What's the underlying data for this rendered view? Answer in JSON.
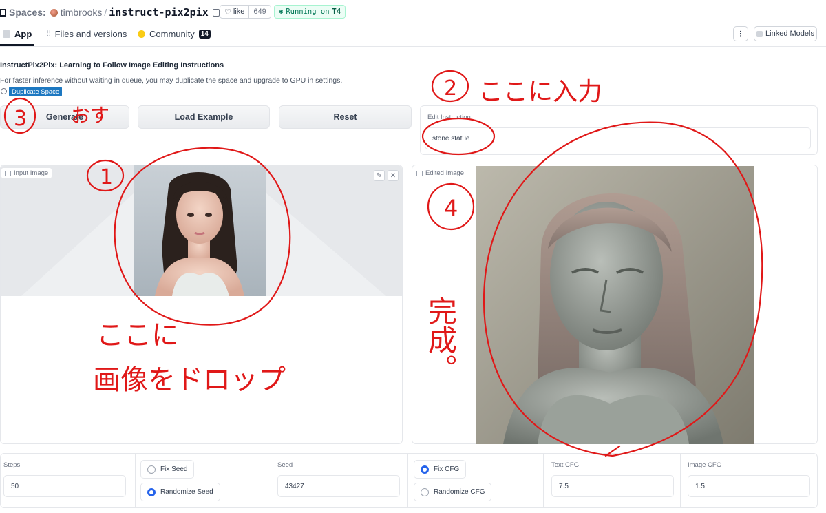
{
  "header": {
    "spaces_label": "Spaces:",
    "owner": "timbrooks",
    "separator": "/",
    "repo": "instruct-pix2pix",
    "like_label": "like",
    "like_count": "649",
    "running_prefix": "Running on",
    "running_hw": "T4",
    "tabs": [
      {
        "label": "App",
        "active": true
      },
      {
        "label": "Files and versions"
      },
      {
        "label": "Community",
        "badge": "14"
      }
    ],
    "more_label": "⋮",
    "linked_models": "Linked Models"
  },
  "app": {
    "title": "InstructPix2Pix: Learning to Follow Image Editing Instructions",
    "description": "For faster inference without waiting in queue, you may duplicate the space and upgrade to GPU in settings.",
    "duplicate_label": "Duplicate Space",
    "buttons": {
      "generate": "Generate",
      "load_example": "Load Example",
      "reset": "Reset"
    },
    "edit_instruction": {
      "label": "Edit Instruction",
      "value": "stone statue"
    },
    "input_image_label": "Input Image",
    "edited_image_label": "Edited Image",
    "controls": {
      "steps": {
        "label": "Steps",
        "value": "50"
      },
      "fix_seed": "Fix Seed",
      "randomize_seed": "Randomize Seed",
      "seed_mode": "Randomize Seed",
      "seed": {
        "label": "Seed",
        "value": "43427"
      },
      "fix_cfg": "Fix CFG",
      "randomize_cfg": "Randomize CFG",
      "cfg_mode": "Fix CFG",
      "text_cfg": {
        "label": "Text CFG",
        "value": "7.5"
      },
      "image_cfg": {
        "label": "Image CFG",
        "value": "1.5"
      }
    }
  },
  "annotations": {
    "n1": "1",
    "n2": "2",
    "n3": "3",
    "n4": "4",
    "push": "おす",
    "type_here": "ここに入力",
    "drop_line1": "ここに",
    "drop_line2": "画像をドロップ",
    "done": "完成。"
  },
  "colors": {
    "accent_blue": "#2563eb",
    "annotation_red": "#e01818",
    "badge_blue": "#1d78c1"
  }
}
